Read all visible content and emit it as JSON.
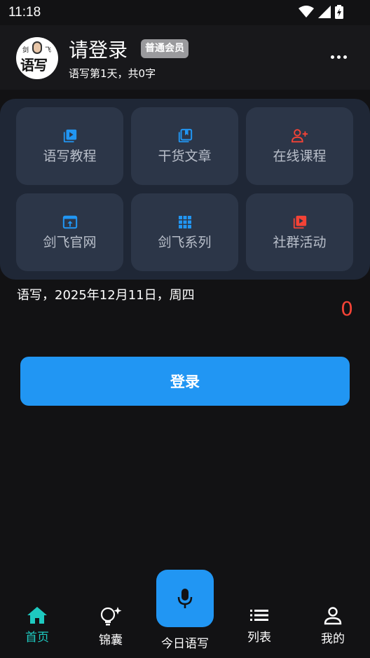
{
  "status_bar": {
    "time": "11:18"
  },
  "header": {
    "avatar_text": "语写",
    "avatar_small_left": "剑",
    "avatar_small_right": "飞",
    "user_name": "请登录",
    "member_badge": "普通会员",
    "subtitle": "语写第1天，共0字"
  },
  "menu": {
    "items": [
      {
        "label": "语写教程",
        "icon": "video-library-icon",
        "color": "#2196f3"
      },
      {
        "label": "干货文章",
        "icon": "book-library-icon",
        "color": "#2196f3"
      },
      {
        "label": "在线课程",
        "icon": "person-add-icon",
        "color": "#f44336"
      },
      {
        "label": "剑飞官网",
        "icon": "open-in-browser-icon",
        "color": "#2196f3"
      },
      {
        "label": "剑飞系列",
        "icon": "apps-grid-icon",
        "color": "#2196f3"
      },
      {
        "label": "社群活动",
        "icon": "slideshow-icon",
        "color": "#f44336"
      }
    ]
  },
  "today": {
    "date_line": "语写，2025年12月11日，周四",
    "count": "0"
  },
  "login_button": "登录",
  "bottom_nav": {
    "home": "首页",
    "tips": "锦囊",
    "today": "今日语写",
    "list": "列表",
    "mine": "我的",
    "active_color": "#1ec9c0"
  }
}
